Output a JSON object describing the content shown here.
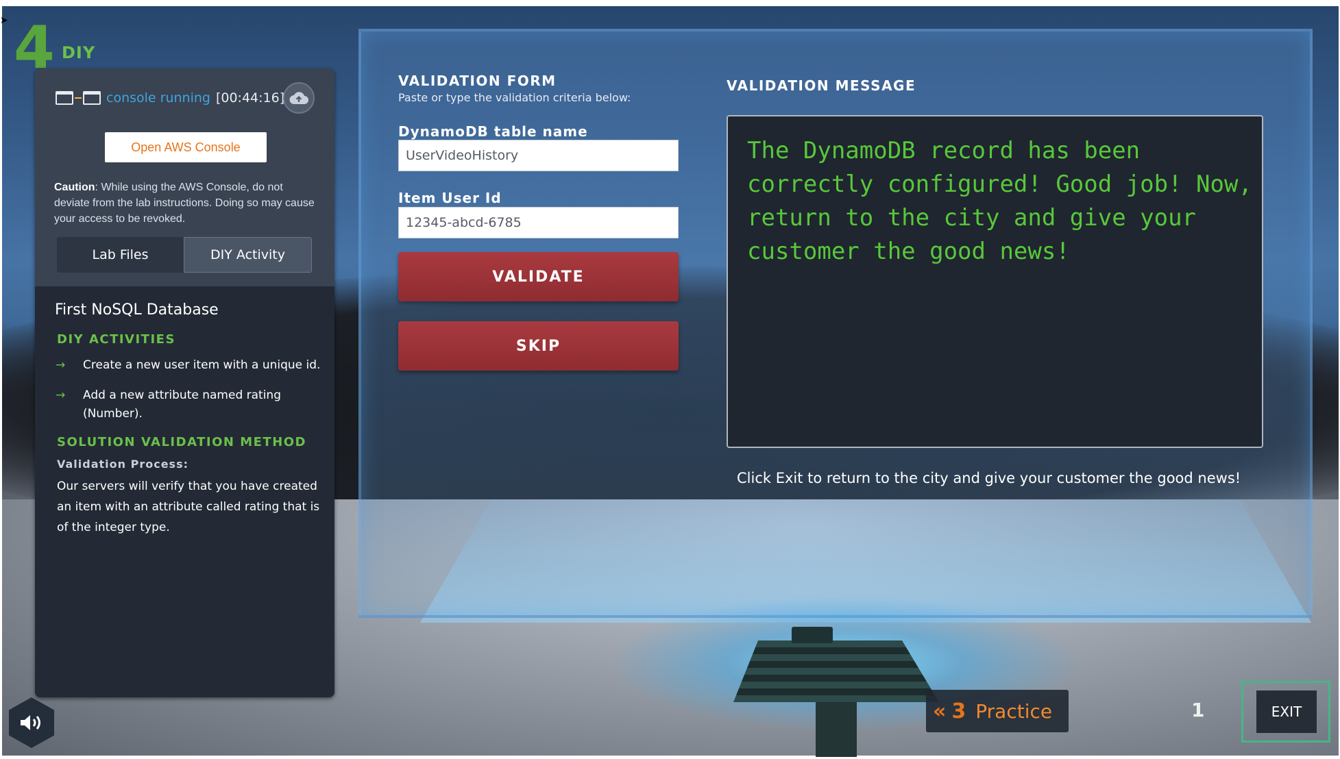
{
  "logo": {
    "number": "4",
    "label": "DIY"
  },
  "console": {
    "status": "console running",
    "timer": "[00:44:16]",
    "open_button": "Open AWS Console",
    "caution_label": "Caution",
    "caution_text": ": While using the AWS Console, do not deviate from the lab instructions. Doing so may cause your access to be revoked."
  },
  "tabs": {
    "lab_files": "Lab Files",
    "diy_activity": "DIY Activity"
  },
  "sidebar": {
    "title": "First NoSQL Database",
    "section_activities": "DIY ACTIVITIES",
    "activities": [
      "Create a new user item with a unique id.",
      "Add a new attribute named rating (Number)."
    ],
    "section_validation": "SOLUTION VALIDATION METHOD",
    "validation_process_label": "Validation Process:",
    "validation_process_text": "Our servers will verify that you have created an item with an attribute called rating that is of the integer type."
  },
  "form": {
    "title": "VALIDATION FORM",
    "subtitle": "Paste or type the validation criteria below:",
    "table_label": "DynamoDB table name",
    "table_value": "UserVideoHistory",
    "item_label": "Item User Id",
    "item_value": "12345-abcd-6785",
    "validate_label": "VALIDATE",
    "skip_label": "SKIP"
  },
  "message": {
    "title": "VALIDATION MESSAGE",
    "body": "The DynamoDB record has been correctly configured! Good job! Now, return to the city and give your customer the good news!",
    "footer": "Click Exit to return to the city and give your customer the good news!"
  },
  "bottom": {
    "practice_number": "3",
    "practice_label": "Practice",
    "badge": "1",
    "exit_label": "EXIT"
  },
  "icons": {
    "console": "window-link-icon",
    "cloud": "cloud-upload-icon",
    "arrow": "arrow-right-icon",
    "sound": "speaker-icon",
    "back": "double-chevron-left-icon"
  },
  "colors": {
    "accent_green": "#6cc04a",
    "message_green": "#58c83a",
    "aws_orange": "#e5751d",
    "button_red": "#a93a3f",
    "exit_frame": "#46b58a"
  }
}
